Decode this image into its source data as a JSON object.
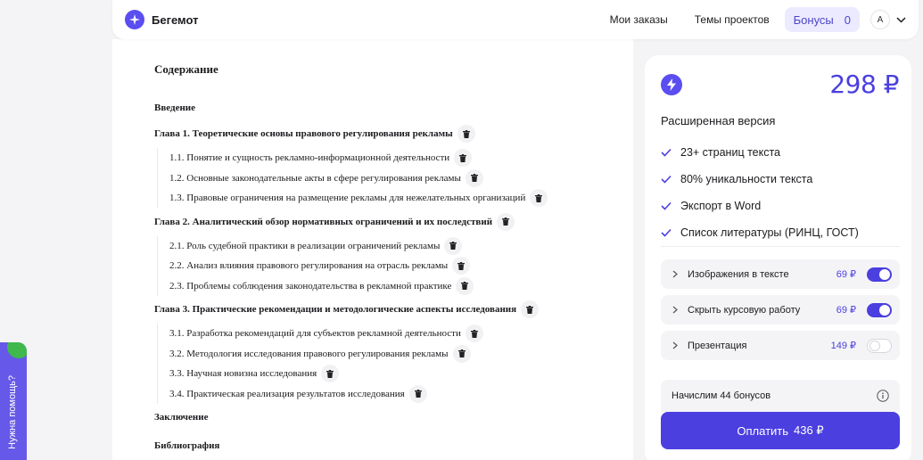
{
  "header": {
    "logo_text": "Бегемот",
    "nav": [
      "Мои заказы",
      "Темы проектов"
    ],
    "bonus_label": "Бонусы",
    "bonus_count": "0",
    "avatar_letter": "A"
  },
  "document": {
    "title": "Содержание",
    "intro": "Введение",
    "chapters": [
      {
        "title": "Глава 1. Теоретические основы правового регулирования рекламы",
        "subs": [
          "1.1. Понятие и сущность рекламно-информационной деятельности",
          "1.2. Основные законодательные акты в сфере регулирования рекламы",
          "1.3. Правовые ограничения на размещение рекламы для нежелательных организаций"
        ]
      },
      {
        "title": "Глава 2. Аналитический обзор нормативных ограничений и их последствий",
        "subs": [
          "2.1. Роль судебной практики в реализации ограничений рекламы",
          "2.2. Анализ влияния правового регулирования на отрасль рекламы",
          "2.3. Проблемы соблюдения законодательства в рекламной практике"
        ]
      },
      {
        "title": "Глава 3. Практические рекомендации и методологические аспекты исследования",
        "subs": [
          "3.1. Разработка рекомендаций для субъектов рекламной деятельности",
          "3.2. Методология исследования правового регулирования рекламы",
          "3.3. Научная новизна исследования",
          "3.4. Практическая реализация результатов исследования"
        ]
      }
    ],
    "conclusion": "Заключение",
    "bibliography": "Библиография"
  },
  "panel": {
    "price": "298 ₽",
    "version": "Расширенная версия",
    "features": [
      "23+ страниц текста",
      "80% уникальности текста",
      "Экспорт в Word",
      "Список литературы (РИНЦ, ГОСТ)"
    ],
    "options": [
      {
        "label": "Изображения в тексте",
        "price": "69 ₽",
        "enabled": true
      },
      {
        "label": "Скрыть курсовую работу",
        "price": "69 ₽",
        "enabled": true
      },
      {
        "label": "Презентация",
        "price": "149 ₽",
        "enabled": false
      }
    ],
    "bonus_note": "Начислим 44 бонусов",
    "pay_label": "Оплатить",
    "pay_amount": "436 ₽"
  },
  "help_tab": "Нужна помощь?",
  "colors": {
    "accent": "#4b3fe0",
    "brand": "#5b4ef0",
    "help_green": "#3fb84c"
  }
}
